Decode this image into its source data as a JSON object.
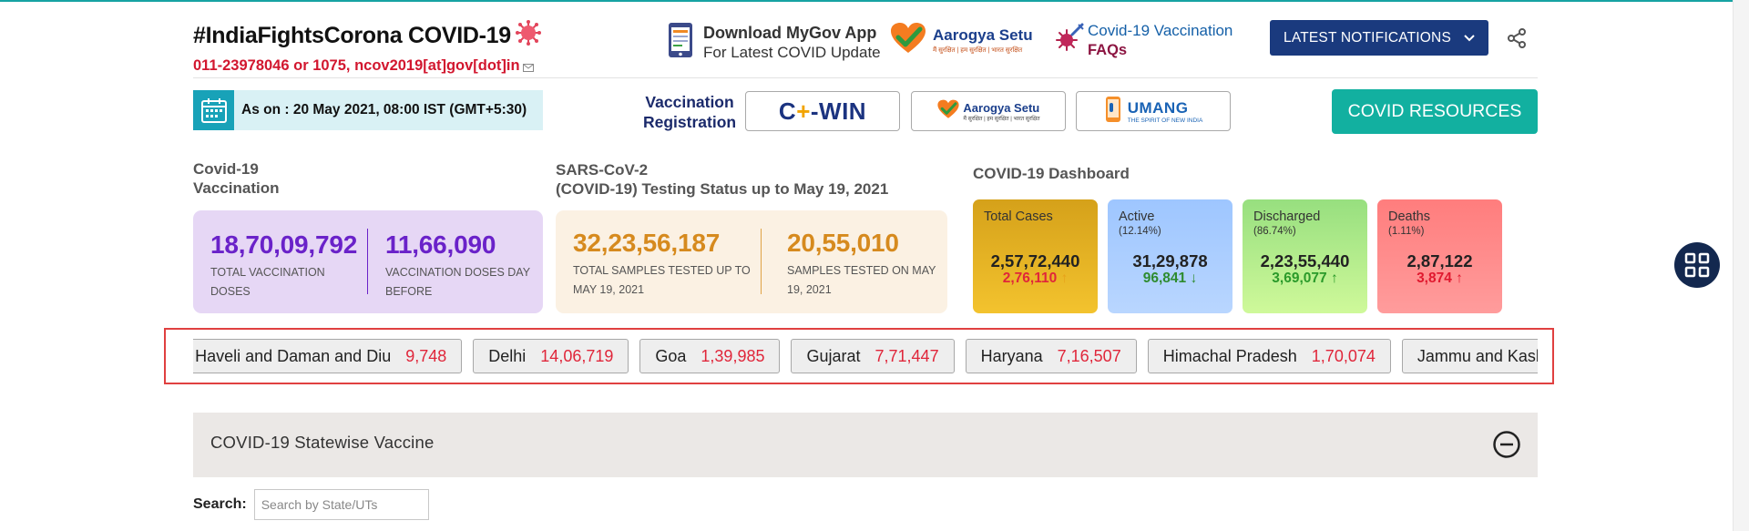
{
  "header": {
    "title": "#IndiaFightsCorona COVID-19",
    "contact": "011-23978046 or 1075, ncov2019[at]gov[dot]in",
    "mygov_line1": "Download MyGov App",
    "mygov_line2": "For Latest COVID Update",
    "aarogya_name": "Aarogya Setu",
    "aarogya_tag": "मैं सुरक्षित | हम सुरक्षित | भारत सुरक्षित",
    "vacc_faq_line1": "Covid-19 Vaccination",
    "vacc_faq_line2": "FAQs",
    "latest_notifications": "LATEST NOTIFICATIONS"
  },
  "subheader": {
    "as_on": "As on : 20 May 2021, 08:00 IST (GMT+5:30)",
    "vacc_reg_line1": "Vaccination",
    "vacc_reg_line2": "Registration",
    "cowin_a": "C",
    "cowin_plus": "+",
    "cowin_b": "-WIN",
    "aarogya_btn_name": "Aarogya Setu",
    "aarogya_btn_tag": "मैं सुरक्षित | हम सुरक्षित | भारत सुरक्षित",
    "umang_name": "UMANG",
    "umang_tag": "THE SPIRIT OF NEW INDIA",
    "covid_resources": "COVID RESOURCES"
  },
  "vaccination": {
    "title_line1": "Covid-19",
    "title_line2": "Vaccination",
    "total_value": "18,70,09,792",
    "total_label": "TOTAL VACCINATION DOSES",
    "daybefore_value": "11,66,090",
    "daybefore_label": "VACCINATION DOSES DAY BEFORE"
  },
  "testing": {
    "title_line1": "SARS-CoV-2",
    "title_line2": "(COVID-19) Testing Status up to May 19, 2021",
    "total_value": "32,23,56,187",
    "total_label": "TOTAL SAMPLES TESTED UP TO MAY 19, 2021",
    "on_value": "20,55,010",
    "on_label": "SAMPLES TESTED ON MAY 19, 2021"
  },
  "dashboard": {
    "title": "COVID-19 Dashboard",
    "cards": [
      {
        "title": "Total Cases",
        "pct": "",
        "value": "2,57,72,440",
        "change": "2,76,110",
        "arrow": "↑"
      },
      {
        "title": "Active",
        "pct": "(12.14%)",
        "value": "31,29,878",
        "change": "96,841",
        "arrow": "↓"
      },
      {
        "title": "Discharged",
        "pct": "(86.74%)",
        "value": "2,23,55,440",
        "change": "3,69,077",
        "arrow": "↑"
      },
      {
        "title": "Deaths",
        "pct": "(1.11%)",
        "value": "2,87,122",
        "change": "3,874",
        "arrow": "↑"
      }
    ]
  },
  "ticker": [
    {
      "state": "Dadra and Nagar Haveli and Daman and Diu",
      "value": "9,748"
    },
    {
      "state": "Delhi",
      "value": "14,06,719"
    },
    {
      "state": "Goa",
      "value": "1,39,985"
    },
    {
      "state": "Gujarat",
      "value": "7,71,447"
    },
    {
      "state": "Haryana",
      "value": "7,16,507"
    },
    {
      "state": "Himachal Pradesh",
      "value": "1,70,074"
    },
    {
      "state": "Jammu and Kashmir",
      "value": ""
    }
  ],
  "statewise": {
    "title": "COVID-19 Statewise Vaccine",
    "search_label": "Search:",
    "search_placeholder": "Search by State/UTs"
  },
  "colors": {
    "accent_teal": "#12b0a0",
    "navy": "#1a3a7e",
    "red": "#e0263a",
    "vaccination_purple": "#6a22c9",
    "testing_orange": "#d68a1e"
  }
}
